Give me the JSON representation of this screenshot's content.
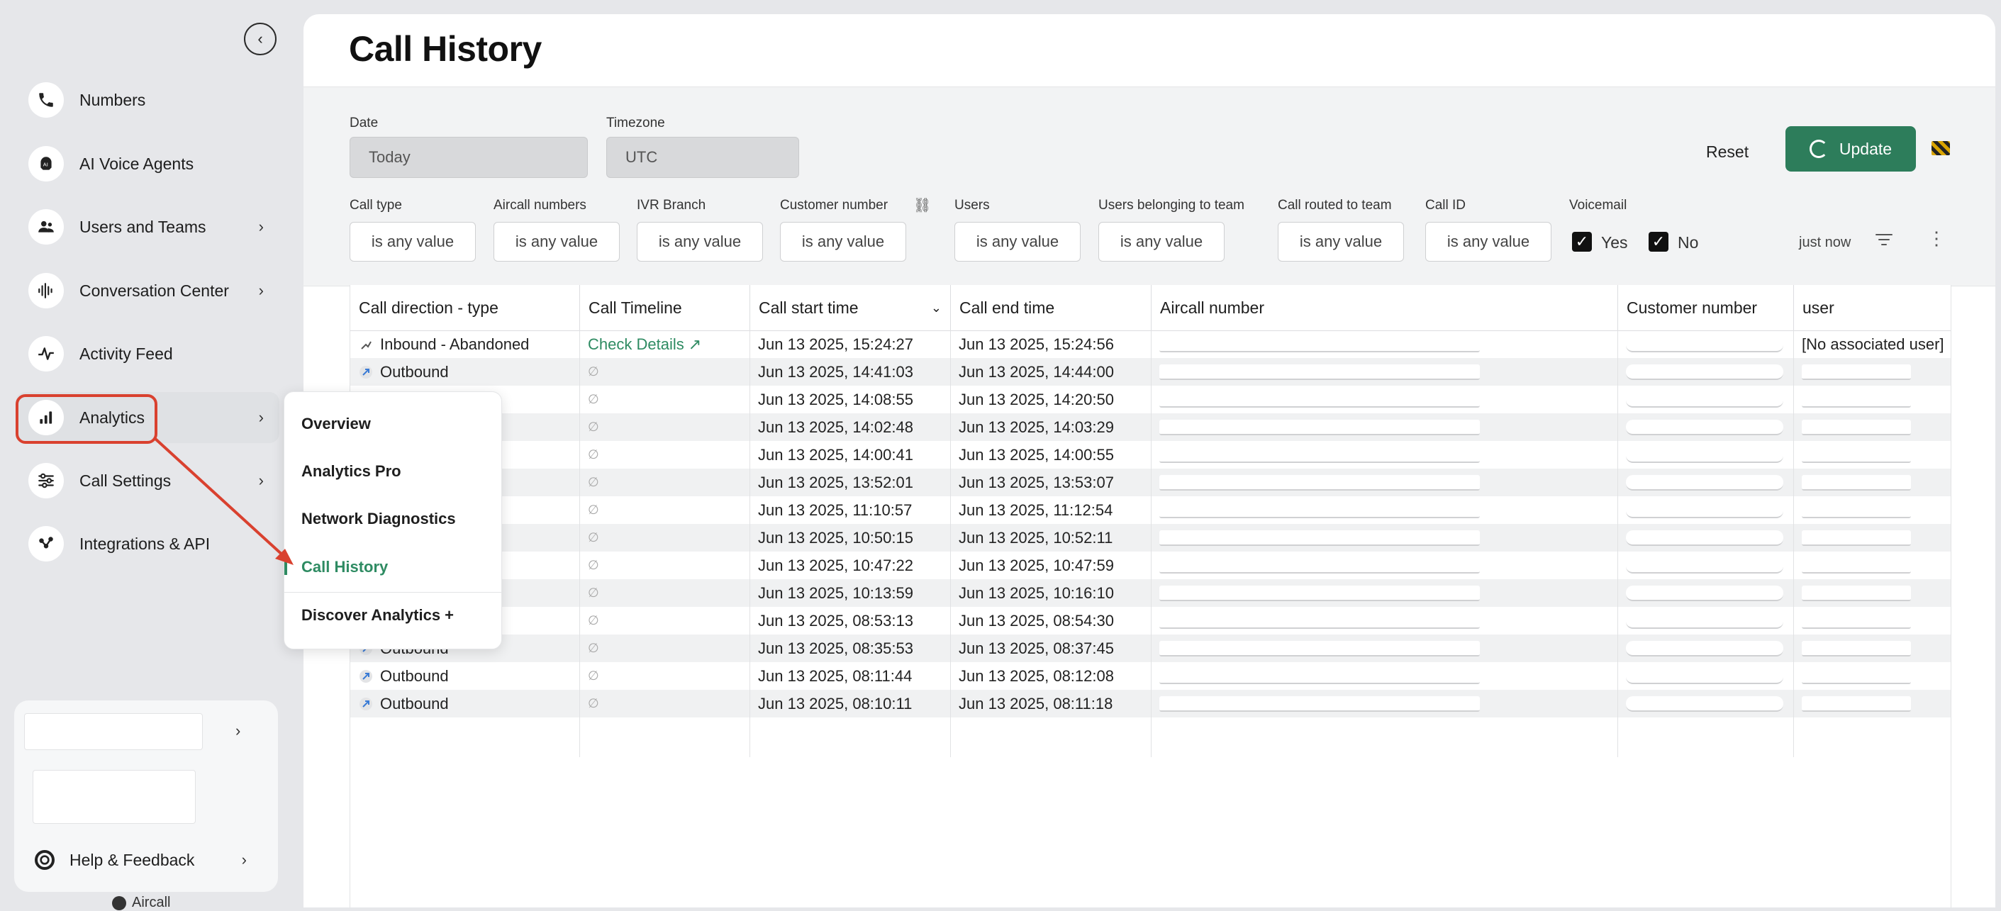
{
  "sidebar": {
    "items": [
      {
        "label": "Numbers",
        "icon": "phone-icon"
      },
      {
        "label": "AI Voice Agents",
        "icon": "ai-agent-icon"
      },
      {
        "label": "Users and Teams",
        "icon": "users-icon"
      },
      {
        "label": "Conversation Center",
        "icon": "waveform-icon"
      },
      {
        "label": "Activity Feed",
        "icon": "pulse-icon"
      },
      {
        "label": "Analytics",
        "icon": "bar-chart-icon"
      },
      {
        "label": "Call Settings",
        "icon": "sliders-icon"
      },
      {
        "label": "Integrations & API",
        "icon": "integrations-icon"
      }
    ],
    "help_label": "Help & Feedback",
    "brand": "Aircall"
  },
  "analytics_menu": {
    "items": [
      "Overview",
      "Analytics Pro",
      "Network Diagnostics",
      "Call History",
      "Discover Analytics +"
    ],
    "active": "Call History"
  },
  "page": {
    "title": "Call History"
  },
  "filters": {
    "date_label": "Date",
    "date_value": "Today",
    "timezone_label": "Timezone",
    "timezone_value": "UTC",
    "reset_label": "Reset",
    "update_label": "Update",
    "call_type_label": "Call type",
    "aircall_numbers_label": "Aircall numbers",
    "ivr_branch_label": "IVR Branch",
    "customer_number_label": "Customer number",
    "users_label": "Users",
    "users_team_label": "Users belonging to team",
    "routed_team_label": "Call routed to team",
    "call_id_label": "Call ID",
    "voicemail_label": "Voicemail",
    "any_value": "is any value",
    "yes_label": "Yes",
    "no_label": "No",
    "refreshed": "just now"
  },
  "table": {
    "headers": [
      "Call direction - type",
      "Call Timeline",
      "Call start time",
      "Call end time",
      "Aircall number",
      "Customer number",
      "user"
    ],
    "rows": [
      {
        "direction": "Inbound - Abandoned",
        "timeline": "Check Details",
        "start": "Jun 13 2025, 15:24:27",
        "end": "Jun 13 2025, 15:24:56",
        "user": "[No associated user]"
      },
      {
        "direction": "Outbound",
        "timeline": "∅",
        "start": "Jun 13 2025, 14:41:03",
        "end": "Jun 13 2025, 14:44:00",
        "user": ""
      },
      {
        "direction": "",
        "timeline": "∅",
        "start": "Jun 13 2025, 14:08:55",
        "end": "Jun 13 2025, 14:20:50",
        "user": ""
      },
      {
        "direction": "",
        "timeline": "∅",
        "start": "Jun 13 2025, 14:02:48",
        "end": "Jun 13 2025, 14:03:29",
        "user": ""
      },
      {
        "direction": "",
        "timeline": "∅",
        "start": "Jun 13 2025, 14:00:41",
        "end": "Jun 13 2025, 14:00:55",
        "user": ""
      },
      {
        "direction": "",
        "timeline": "∅",
        "start": "Jun 13 2025, 13:52:01",
        "end": "Jun 13 2025, 13:53:07",
        "user": ""
      },
      {
        "direction": "",
        "timeline": "∅",
        "start": "Jun 13 2025, 11:10:57",
        "end": "Jun 13 2025, 11:12:54",
        "user": ""
      },
      {
        "direction": "",
        "timeline": "∅",
        "start": "Jun 13 2025, 10:50:15",
        "end": "Jun 13 2025, 10:52:11",
        "user": ""
      },
      {
        "direction": "",
        "timeline": "∅",
        "start": "Jun 13 2025, 10:47:22",
        "end": "Jun 13 2025, 10:47:59",
        "user": ""
      },
      {
        "direction": "",
        "timeline": "∅",
        "start": "Jun 13 2025, 10:13:59",
        "end": "Jun 13 2025, 10:16:10",
        "user": ""
      },
      {
        "direction": "",
        "timeline": "∅",
        "start": "Jun 13 2025, 08:53:13",
        "end": "Jun 13 2025, 08:54:30",
        "user": ""
      },
      {
        "direction": "Outbound",
        "timeline": "∅",
        "start": "Jun 13 2025, 08:35:53",
        "end": "Jun 13 2025, 08:37:45",
        "user": ""
      },
      {
        "direction": "Outbound",
        "timeline": "∅",
        "start": "Jun 13 2025, 08:11:44",
        "end": "Jun 13 2025, 08:12:08",
        "user": ""
      },
      {
        "direction": "Outbound",
        "timeline": "∅",
        "start": "Jun 13 2025, 08:10:11",
        "end": "Jun 13 2025, 08:11:18",
        "user": ""
      }
    ]
  },
  "colors": {
    "accent_green": "#2d7d5b",
    "highlight_red": "#d9412f"
  }
}
